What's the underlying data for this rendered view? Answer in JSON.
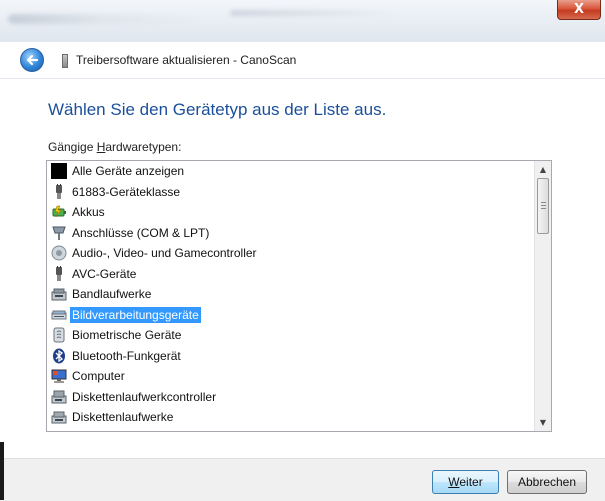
{
  "window": {
    "title": "Treibersoftware aktualisieren - CanoScan",
    "close_glyph": "X"
  },
  "heading": "Wählen Sie den Gerätetyp aus der Liste aus.",
  "list": {
    "label_prefix": "Gängige ",
    "label_accel": "H",
    "label_rest": "ardwaretypen:",
    "items": [
      {
        "label": "Alle Geräte anzeigen",
        "icon": "black-square-icon",
        "selected": false
      },
      {
        "label": "61883-Geräteklasse",
        "icon": "plug-icon",
        "selected": false
      },
      {
        "label": "Akkus",
        "icon": "battery-icon",
        "selected": false
      },
      {
        "label": "Anschlüsse (COM & LPT)",
        "icon": "port-icon",
        "selected": false
      },
      {
        "label": "Audio-, Video- und Gamecontroller",
        "icon": "speaker-icon",
        "selected": false
      },
      {
        "label": "AVC-Geräte",
        "icon": "plug-icon",
        "selected": false
      },
      {
        "label": "Bandlaufwerke",
        "icon": "tape-drive-icon",
        "selected": false
      },
      {
        "label": "Bildverarbeitungsgeräte",
        "icon": "scanner-icon",
        "selected": true
      },
      {
        "label": "Biometrische Geräte",
        "icon": "biometric-icon",
        "selected": false
      },
      {
        "label": "Bluetooth-Funkgerät",
        "icon": "bluetooth-icon",
        "selected": false
      },
      {
        "label": "Computer",
        "icon": "computer-icon",
        "selected": false
      },
      {
        "label": "Diskettenlaufwerkcontroller",
        "icon": "floppy-controller-icon",
        "selected": false
      },
      {
        "label": "Diskettenlaufwerke",
        "icon": "floppy-drive-icon",
        "selected": false
      }
    ]
  },
  "buttons": {
    "next_accel": "W",
    "next_rest": "eiter",
    "cancel": "Abbrechen"
  },
  "colors": {
    "heading": "#1b4f9b",
    "selection": "#3399ff"
  }
}
